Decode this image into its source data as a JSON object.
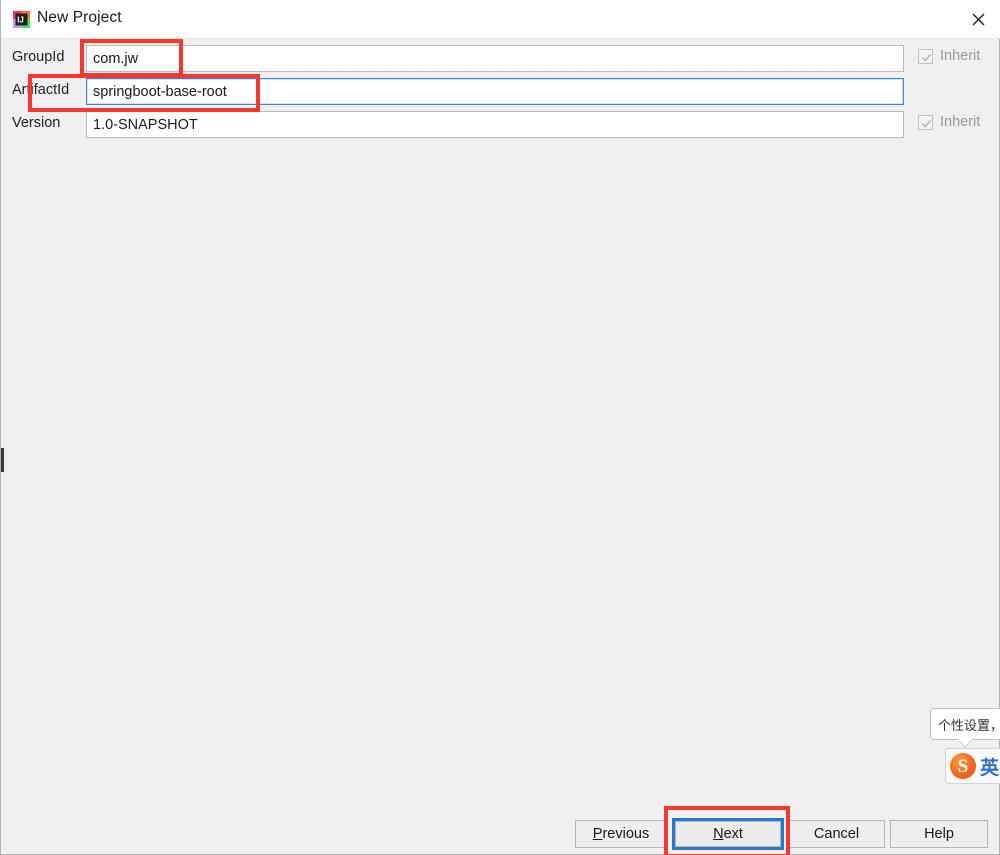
{
  "window": {
    "title": "New Project",
    "app_icon": "intellij-idea-icon",
    "close_label": "×"
  },
  "form": {
    "rows": [
      {
        "label": "GroupId",
        "value": "com.jw",
        "focused": false,
        "inherit": {
          "label": "Inherit",
          "checked": true,
          "enabled": false
        }
      },
      {
        "label": "ArtifactId",
        "value": "springboot-base-root",
        "focused": true,
        "inherit": null
      },
      {
        "label": "Version",
        "value": "1.0-SNAPSHOT",
        "focused": false,
        "inherit": {
          "label": "Inherit",
          "checked": true,
          "enabled": false
        }
      }
    ]
  },
  "buttons": {
    "previous": {
      "pre": "P",
      "post": "revious"
    },
    "next": {
      "pre": "N",
      "post": "ext"
    },
    "cancel": "Cancel",
    "help": "Help"
  },
  "annotations": {
    "accent_color": "#f5392e",
    "targets": [
      "groupid-field",
      "artifactid-field",
      "next-button"
    ]
  },
  "ime": {
    "tooltip": "个性设置，",
    "logo": "S",
    "mode": "英",
    "caret": "▾"
  },
  "colors": {
    "titlebar_bg": "#ffffff",
    "body_bg": "#f0f0f0",
    "focus_blue": "#3d87d6",
    "button_focus_blue": "#2879d0",
    "annotation_red": "#f5392e"
  }
}
